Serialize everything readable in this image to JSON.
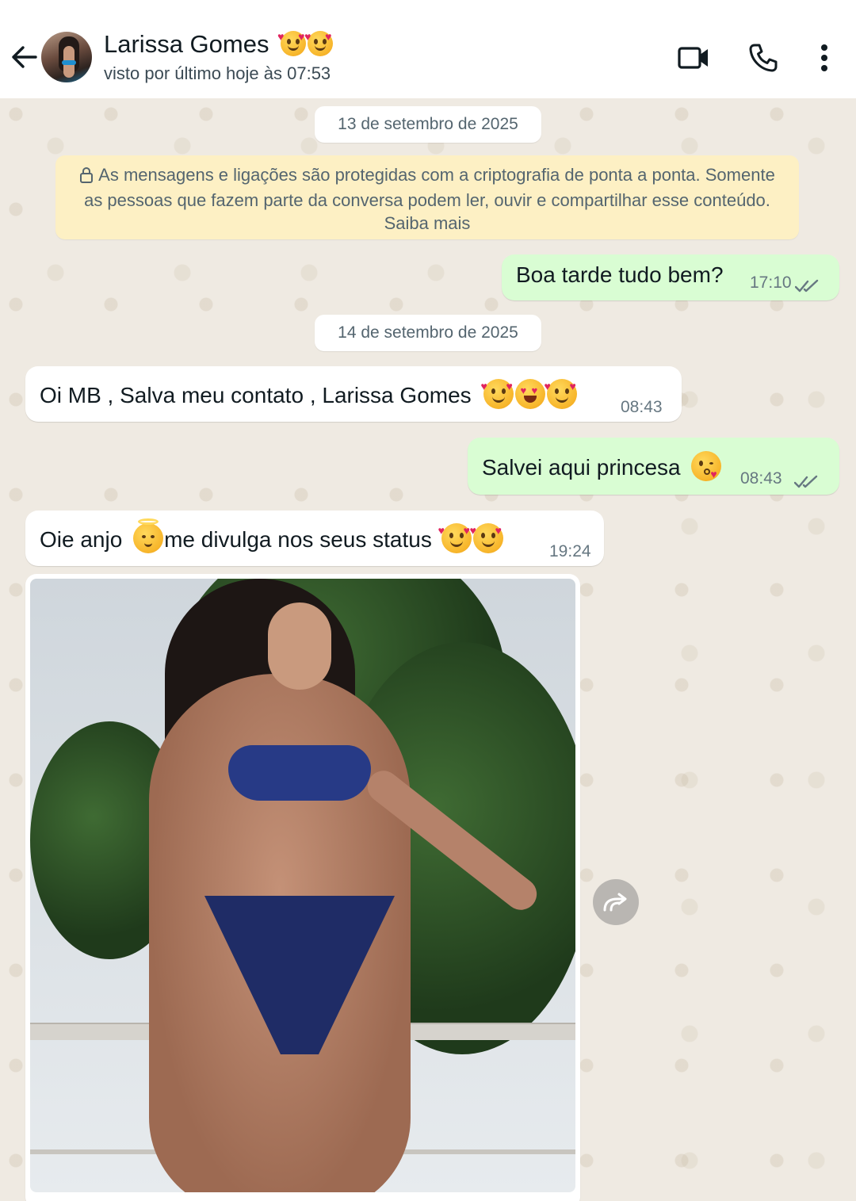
{
  "header": {
    "contact_name": "Larissa Gomes",
    "contact_status": "visto por último hoje às 07:53",
    "name_emojis": [
      "smiling-face-with-hearts",
      "smiling-face-with-hearts"
    ],
    "icons": [
      "back-arrow-icon",
      "video-call-icon",
      "phone-icon",
      "more-vert-icon"
    ]
  },
  "chat": {
    "date_1": "13 de setembro de 2025",
    "encryption_notice": "As mensagens e ligações são protegidas com a criptografia de ponta a ponta. Somente as pessoas que fazem parte da conversa podem ler, ouvir e compartilhar esse conteúdo. Saiba mais",
    "date_2": "14 de setembro de 2025",
    "messages": [
      {
        "direction": "out",
        "text": "Boa tarde tudo bem?",
        "time": "17:10",
        "status": "read"
      },
      {
        "direction": "in",
        "text": "Oi MB , Salva meu contato , Larissa Gomes",
        "emojis": [
          "smiling-face-with-hearts",
          "heart-eyes",
          "smiling-face-with-hearts"
        ],
        "time": "08:43"
      },
      {
        "direction": "out",
        "text": "Salvei aqui princesa",
        "emojis": [
          "face-blowing-kiss"
        ],
        "time": "08:43",
        "status": "read"
      },
      {
        "direction": "in",
        "text_before": "Oie anjo",
        "emoji_mid": "baby-angel",
        "text_after": "me divulga nos seus status",
        "emojis": [
          "smiling-face-with-hearts",
          "smiling-face-with-hearts"
        ],
        "time": "19:24"
      },
      {
        "direction": "in",
        "type": "image",
        "image_desc_icon": "photo"
      }
    ]
  },
  "colors": {
    "chat_bg": "#efeae2",
    "outgoing_bubble": "#d9fdd3",
    "incoming_bubble": "#ffffff",
    "encryption_bg": "#fdf0c4",
    "read_ticks": "#667781"
  }
}
